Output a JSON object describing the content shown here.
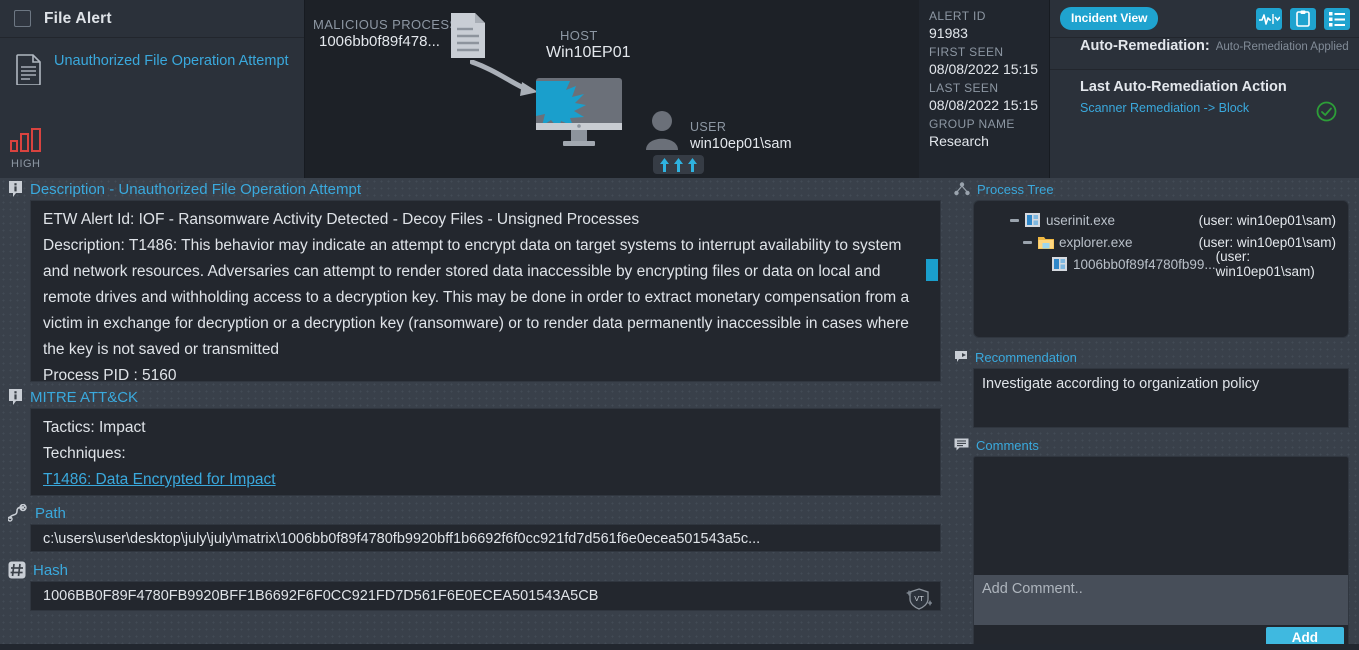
{
  "alert": {
    "header_title": "File Alert",
    "name": "Unauthorized File Operation Attempt",
    "severity_label": "HIGH",
    "severity_color": "#d9433f",
    "doc_icon": "document-icon",
    "checkbox_icon": "checkbox-unchecked"
  },
  "graph": {
    "malicious_process_label": "MALICIOUS PROCESS",
    "malicious_process_value": "1006bb0f89f478...",
    "host_label": "HOST",
    "host_value": "Win10EP01",
    "user_label": "USER",
    "user_value": "win10ep01\\sam",
    "file_icon": "file-document-icon",
    "monitor_icon": "compromised-monitor-icon",
    "user_icon": "user-avatar-icon",
    "arrow_icon": "attack-arrow-icon",
    "uplink_icon": "triple-up-arrow-badge"
  },
  "meta": {
    "alert_id_label": "ALERT ID",
    "alert_id_value": "91983",
    "first_seen_label": "FIRST SEEN",
    "first_seen_value": "08/08/2022 15:15",
    "last_seen_label": "LAST SEEN",
    "last_seen_value": "08/08/2022 15:15",
    "group_name_label": "GROUP NAME",
    "group_name_value": "Research"
  },
  "toolbar": {
    "incident_view_label": "Incident View",
    "icons": [
      "activity-dropdown-icon",
      "clipboard-icon",
      "list-icon"
    ]
  },
  "remediation": {
    "auto_label": "Auto-Remediation:",
    "auto_value": "Auto-Remediation Applied",
    "last_action_title": "Last Auto-Remediation Action",
    "last_action_value": "Scanner Remediation -> Block",
    "status_icon": "green-check-circle-icon",
    "status_color": "#2d9e38"
  },
  "description": {
    "section_icon": "info-bubble-icon",
    "title": "Description - Unauthorized File Operation Attempt",
    "line1": "ETW Alert Id: IOF - Ransomware Activity Detected - Decoy Files - Unsigned Processes",
    "line2": "Description: T1486: This behavior may indicate an attempt to encrypt data on target systems to interrupt availability to system and network resources. Adversaries can attempt to render stored data inaccessible by encrypting files or data on local and remote drives and withholding access to a decryption key. This may be done in order to extract monetary compensation from a victim in exchange for decryption or a decryption key (ransomware) or to render data permanently inaccessible in cases where the key is not saved or transmitted",
    "line3": "Process PID : 5160"
  },
  "mitre": {
    "section_icon": "info-bubble-icon",
    "title": "MITRE ATT&CK",
    "tactics": "Tactics: Impact",
    "techniques_label": "Techniques:",
    "technique_link": "T1486: Data Encrypted for Impact"
  },
  "path": {
    "section_icon": "path-route-icon",
    "title": "Path",
    "value": "c:\\users\\user\\desktop\\july\\july\\matrix\\1006bb0f89f4780fb9920bff1b6692f6f0cc921fd7d561f6e0ecea501543a5c..."
  },
  "hash": {
    "section_icon": "hash-icon",
    "title": "Hash",
    "value": "1006BB0F89F4780FB9920BFF1B6692F6F0CC921FD7D561F6E0ECEA501543A5CB",
    "vt_badge": "VT",
    "vt_badge_icon": "virustotal-shield-icon"
  },
  "process_tree": {
    "section_icon": "process-tree-icon",
    "title": "Process Tree",
    "rows": [
      {
        "name": "userinit.exe",
        "user": "(user: win10ep01\\sam)",
        "depth": 0,
        "icon": "app-window-icon",
        "toggle": "collapse-minus"
      },
      {
        "name": "explorer.exe",
        "user": "(user: win10ep01\\sam)",
        "depth": 1,
        "icon": "folder-icon",
        "toggle": "collapse-minus"
      },
      {
        "name": "1006bb0f89f4780fb99...",
        "user": "(user: win10ep01\\sam)",
        "depth": 2,
        "icon": "app-window-icon",
        "toggle": "none"
      }
    ]
  },
  "recommendation": {
    "section_icon": "recommendation-flag-icon",
    "title": "Recommendation",
    "text": "Investigate according to organization policy"
  },
  "comments": {
    "section_icon": "comment-bubble-icon",
    "title": "Comments",
    "input_placeholder": "Add Comment..",
    "input_value": "",
    "add_button_label": "Add"
  },
  "theme": {
    "accent": "#3aa9dd",
    "pill": "#1fa3cf",
    "bg_dark": "#1d2127",
    "bg_panel": "#23272e",
    "bg_body": "#39404a"
  }
}
